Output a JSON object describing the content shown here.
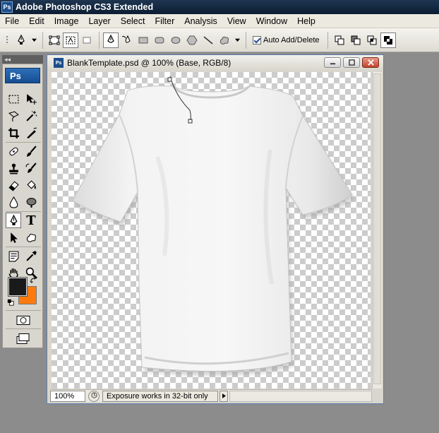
{
  "app": {
    "badge": "Ps",
    "title": "Adobe Photoshop CS3 Extended"
  },
  "menu": [
    "File",
    "Edit",
    "Image",
    "Layer",
    "Select",
    "Filter",
    "Analysis",
    "View",
    "Window",
    "Help"
  ],
  "options": {
    "auto_add_delete_label": "Auto Add/Delete",
    "auto_add_delete_checked": true
  },
  "tools": {
    "logo": "Ps",
    "type_tool_glyph": "T",
    "panel_grip": "◂◂",
    "foreground_color": "#1a1a1a",
    "background_color": "#ff7a0e"
  },
  "document": {
    "title": "BlankTemplate.psd @ 100% (Base, RGB/8)",
    "icon_label": "Ps",
    "zoom": "100%",
    "status_text": "Exposure works in 32-bit only"
  }
}
